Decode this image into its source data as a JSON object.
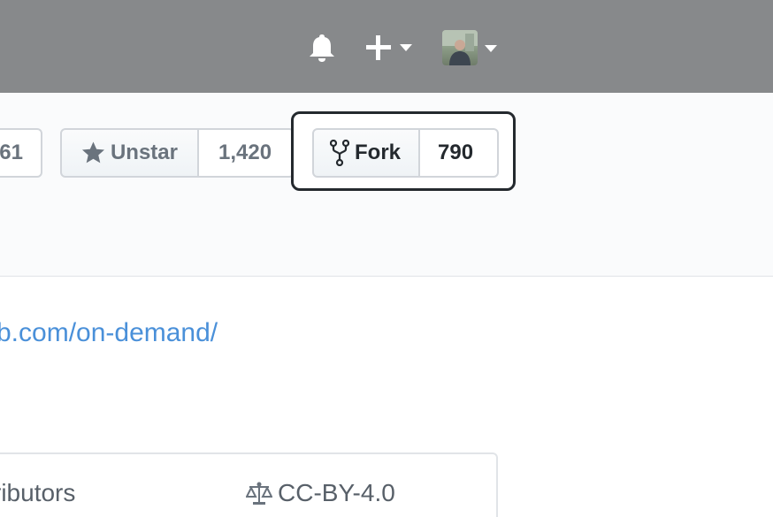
{
  "header": {
    "notifications_icon": "bell-icon",
    "create_icon": "plus-icon",
    "user_icon": "avatar"
  },
  "repo_actions": {
    "watch": {
      "count": "61"
    },
    "star": {
      "label": "Unstar",
      "count": "1,420",
      "icon": "star-icon"
    },
    "fork": {
      "label": "Fork",
      "count": "790",
      "icon": "repo-forked-icon"
    }
  },
  "about": {
    "homepage_text": "b.com/on-demand/"
  },
  "summary": {
    "contributors_label": "ributors",
    "license_label": "CC-BY-4.0",
    "license_icon": "law-icon"
  },
  "colors": {
    "header_bg": "#87898b",
    "link": "#4a90d9",
    "highlight_border": "#24292e"
  }
}
